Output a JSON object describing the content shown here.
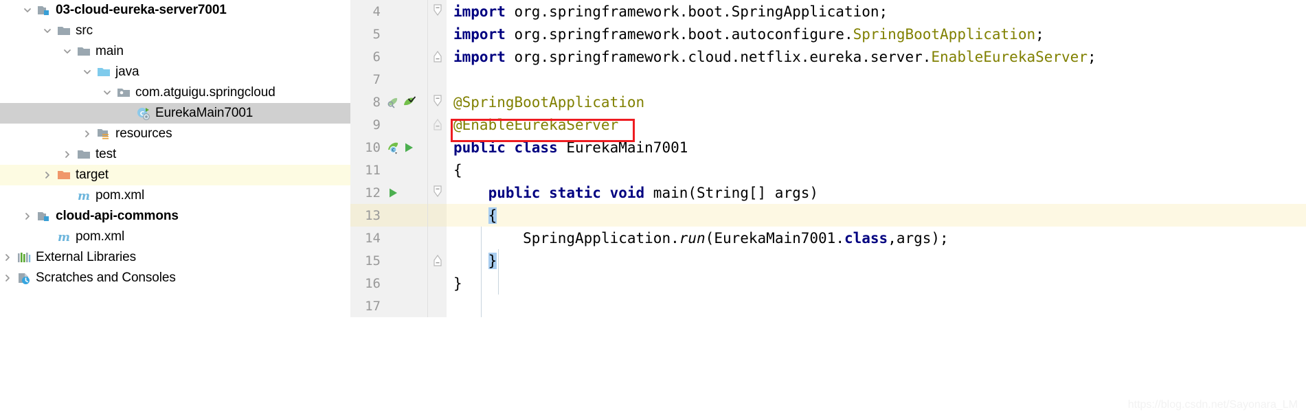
{
  "project_tree": {
    "items": [
      {
        "label": "03-cloud-eureka-server7001",
        "icon": "module-folder-icon",
        "arrow": "chevron-down",
        "indent": 1,
        "bold": true,
        "state": "normal"
      },
      {
        "label": "src",
        "icon": "folder-icon",
        "arrow": "chevron-down",
        "indent": 2,
        "bold": false,
        "state": "normal"
      },
      {
        "label": "main",
        "icon": "folder-icon",
        "arrow": "chevron-down",
        "indent": 3,
        "bold": false,
        "state": "normal"
      },
      {
        "label": "java",
        "icon": "source-folder-icon",
        "arrow": "chevron-down",
        "indent": 4,
        "bold": false,
        "state": "normal"
      },
      {
        "label": "com.atguigu.springcloud",
        "icon": "package-icon",
        "arrow": "chevron-down",
        "indent": 5,
        "bold": false,
        "state": "normal"
      },
      {
        "label": "EurekaMain7001",
        "icon": "java-class-runnable-icon",
        "arrow": "none",
        "indent": 6,
        "bold": false,
        "state": "selected"
      },
      {
        "label": "resources",
        "icon": "resources-folder-icon",
        "arrow": "chevron-right",
        "indent": 4,
        "bold": false,
        "state": "normal"
      },
      {
        "label": "test",
        "icon": "folder-icon",
        "arrow": "chevron-right",
        "indent": 3,
        "bold": false,
        "state": "normal"
      },
      {
        "label": "target",
        "icon": "excluded-folder-icon",
        "arrow": "chevron-right",
        "indent": 2,
        "bold": false,
        "state": "excluded"
      },
      {
        "label": "pom.xml",
        "icon": "maven-file-icon",
        "arrow": "none",
        "indent": 3,
        "bold": false,
        "state": "normal"
      },
      {
        "label": "cloud-api-commons",
        "icon": "module-folder-icon",
        "arrow": "chevron-right",
        "indent": 1,
        "bold": true,
        "state": "normal"
      },
      {
        "label": "pom.xml",
        "icon": "maven-file-icon",
        "arrow": "none",
        "indent": 2,
        "bold": false,
        "state": "normal"
      },
      {
        "label": "External Libraries",
        "icon": "external-libraries-icon",
        "arrow": "chevron-right",
        "indent": 0,
        "bold": false,
        "state": "normal"
      },
      {
        "label": "Scratches and Consoles",
        "icon": "scratches-icon",
        "arrow": "chevron-right",
        "indent": 0,
        "bold": false,
        "state": "normal"
      }
    ]
  },
  "editor": {
    "lines": [
      {
        "number": "4",
        "fold": "fold-start",
        "gutter_icons": [],
        "caret": false,
        "tokens": [
          {
            "t": "import ",
            "c": "kw"
          },
          {
            "t": "org.springframework.boot.SpringApplication;",
            "c": "plain"
          }
        ]
      },
      {
        "number": "5",
        "fold": "none",
        "gutter_icons": [],
        "caret": false,
        "tokens": [
          {
            "t": "import ",
            "c": "kw"
          },
          {
            "t": "org.springframework.boot.autoconfigure.",
            "c": "plain"
          },
          {
            "t": "SpringBootApplication",
            "c": "cls"
          },
          {
            "t": ";",
            "c": "plain"
          }
        ]
      },
      {
        "number": "6",
        "fold": "fold-end",
        "gutter_icons": [],
        "caret": false,
        "tokens": [
          {
            "t": "import ",
            "c": "kw"
          },
          {
            "t": "org.springframework.cloud.netflix.eureka.server.",
            "c": "plain"
          },
          {
            "t": "EnableEurekaServer",
            "c": "cls"
          },
          {
            "t": ";",
            "c": "plain"
          }
        ]
      },
      {
        "number": "7",
        "fold": "none",
        "gutter_icons": [],
        "caret": false,
        "tokens": []
      },
      {
        "number": "8",
        "fold": "fold-start",
        "gutter_icons": [
          "spring-bean-search-icon",
          "spring-bean-check-icon"
        ],
        "caret": false,
        "tokens": [
          {
            "t": "@SpringBootApplication",
            "c": "ann"
          }
        ]
      },
      {
        "number": "9",
        "fold": "fold-collapse",
        "gutter_icons": [],
        "caret": false,
        "tokens": [
          {
            "t": "@EnableEurekaServer",
            "c": "ann"
          }
        ]
      },
      {
        "number": "10",
        "fold": "none",
        "gutter_icons": [
          "spring-bean-class-icon",
          "run-arrow-icon"
        ],
        "caret": false,
        "tokens": [
          {
            "t": "public class ",
            "c": "kw"
          },
          {
            "t": "EurekaMain7001",
            "c": "plain"
          }
        ]
      },
      {
        "number": "11",
        "fold": "none",
        "gutter_icons": [],
        "caret": false,
        "tokens": [
          {
            "t": "{",
            "c": "plain"
          }
        ]
      },
      {
        "number": "12",
        "fold": "fold-start",
        "gutter_icons": [
          "run-arrow-icon"
        ],
        "caret": false,
        "tokens": [
          {
            "t": "    ",
            "c": "plain"
          },
          {
            "t": "public static void ",
            "c": "kw"
          },
          {
            "t": "main(String[] args)",
            "c": "plain"
          }
        ]
      },
      {
        "number": "13",
        "fold": "none",
        "gutter_icons": [],
        "caret": true,
        "tokens": [
          {
            "t": "    ",
            "c": "plain"
          },
          {
            "t": "{",
            "c": "brace"
          }
        ]
      },
      {
        "number": "14",
        "fold": "none",
        "gutter_icons": [],
        "caret": false,
        "tokens": [
          {
            "t": "        ",
            "c": "plain"
          },
          {
            "t": "SpringApplication.",
            "c": "plain"
          },
          {
            "t": "run",
            "c": "italic"
          },
          {
            "t": "(EurekaMain7001.",
            "c": "plain"
          },
          {
            "t": "class",
            "c": "kw"
          },
          {
            "t": ",args);",
            "c": "plain"
          }
        ]
      },
      {
        "number": "15",
        "fold": "fold-end",
        "gutter_icons": [],
        "caret": false,
        "tokens": [
          {
            "t": "    ",
            "c": "plain"
          },
          {
            "t": "}",
            "c": "brace"
          }
        ]
      },
      {
        "number": "16",
        "fold": "none",
        "gutter_icons": [],
        "caret": false,
        "tokens": [
          {
            "t": "}",
            "c": "plain"
          }
        ]
      },
      {
        "number": "17",
        "fold": "none",
        "gutter_icons": [],
        "caret": false,
        "tokens": []
      }
    ],
    "annotation": {
      "type": "red-rectangle",
      "target_text": "@EnableEurekaServer",
      "color": "#ee1c21"
    }
  },
  "watermark": {
    "text": "https://blog.csdn.net/Sayonara_LM"
  },
  "colors": {
    "keyword": "#000080",
    "annotation": "#808000",
    "class_ref": "#808000",
    "selection": "#d0d0d0",
    "caret_line": "#fdf8e3",
    "excluded_row": "#fdfbe2",
    "brace_match": "#a8cdf0",
    "gutter": "#f1f1f1",
    "red_box": "#ee1c21"
  }
}
